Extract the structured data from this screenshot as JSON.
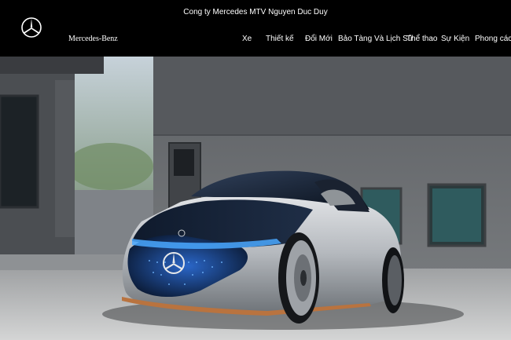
{
  "header": {
    "company_name": "Cong ty Mercedes MTV Nguyen Duc Duy",
    "brand_name": "Mercedes-Benz",
    "logo_icon": "mercedes-star-icon"
  },
  "nav": {
    "items": [
      {
        "label": "Xe"
      },
      {
        "label": "Thiết kế"
      },
      {
        "label": "Đổi Mới"
      },
      {
        "label": "Bảo Tàng Và Lịch Sử"
      },
      {
        "label": "Thể thao"
      },
      {
        "label": "Sự Kiện"
      },
      {
        "label": "Phong cách"
      }
    ]
  },
  "hero": {
    "image_subject": "silver-and-black concept electric sedan"
  },
  "colors": {
    "header_bg": "#000000",
    "header_text": "#ffffff",
    "car_silver": "#c9ccd0",
    "car_black": "#0c1420",
    "light_strip_blue": "#4aa8ff",
    "trim_copper": "#b9733f"
  }
}
